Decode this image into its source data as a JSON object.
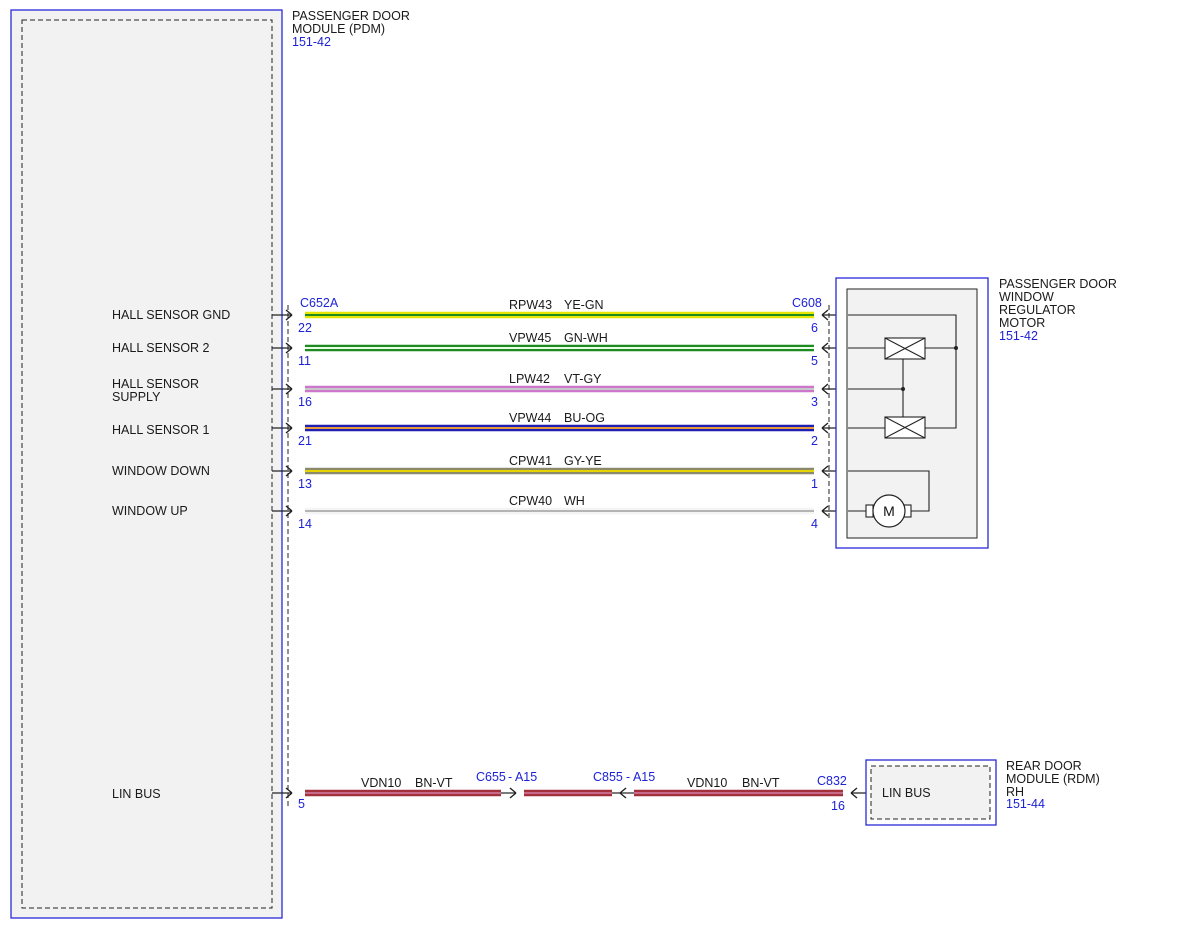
{
  "pdm": {
    "name_lines": [
      "PASSENGER DOOR",
      "MODULE (PDM)"
    ],
    "ref": "151-42",
    "connector": "C652A",
    "pins": [
      {
        "label_lines": [
          "HALL SENSOR GND"
        ],
        "pin": "22"
      },
      {
        "label_lines": [
          "HALL SENSOR 2"
        ],
        "pin": "11"
      },
      {
        "label_lines": [
          "HALL SENSOR",
          "SUPPLY"
        ],
        "pin": "16"
      },
      {
        "label_lines": [
          "HALL SENSOR 1"
        ],
        "pin": "21"
      },
      {
        "label_lines": [
          "WINDOW DOWN"
        ],
        "pin": "13"
      },
      {
        "label_lines": [
          "WINDOW UP"
        ],
        "pin": "14"
      },
      {
        "label_lines": [
          "LIN BUS"
        ],
        "pin": "5"
      }
    ]
  },
  "motor": {
    "name_lines": [
      "PASSENGER DOOR",
      "WINDOW",
      "REGULATOR",
      "MOTOR"
    ],
    "ref": "151-42",
    "connector": "C608",
    "symbol_label": "M"
  },
  "rdm": {
    "name_lines": [
      "REAR DOOR",
      "MODULE (RDM)",
      "RH"
    ],
    "ref": "151-44",
    "connector": "C832",
    "pin": "16",
    "pin_label": "LIN BUS"
  },
  "wires": [
    {
      "circuit": "RPW43",
      "color_code": "YE-GN",
      "from_pin": "22",
      "to_pin": "6",
      "colors": [
        "#e6e600",
        "#1e8c1e"
      ]
    },
    {
      "circuit": "VPW45",
      "color_code": "GN-WH",
      "from_pin": "11",
      "to_pin": "5",
      "colors": [
        "#1f8a1f",
        "#e8ffe8"
      ]
    },
    {
      "circuit": "LPW42",
      "color_code": "VT-GY",
      "from_pin": "16",
      "to_pin": "3",
      "colors": [
        "#cc77cc",
        "#c8c8c8"
      ]
    },
    {
      "circuit": "VPW44",
      "color_code": "BU-OG",
      "from_pin": "21",
      "to_pin": "2",
      "colors": [
        "#1f1fb4",
        "#e89a3c"
      ]
    },
    {
      "circuit": "CPW41",
      "color_code": "GY-YE",
      "from_pin": "13",
      "to_pin": "1",
      "colors": [
        "#8a8a6a",
        "#e6d400"
      ]
    },
    {
      "circuit": "CPW40",
      "color_code": "WH",
      "from_pin": "14",
      "to_pin": "4",
      "colors": [
        "#f4f4f4",
        "#b4b4b4"
      ]
    }
  ],
  "lin": {
    "seg1": {
      "circuit": "VDN10",
      "color_code": "BN-VT"
    },
    "seg2": {
      "circuit": "VDN10",
      "color_code": "BN-VT"
    },
    "inline1": {
      "connector": "C655",
      "pin": "- A15"
    },
    "inline2": {
      "connector": "C855",
      "pin": "- A15"
    },
    "colors": [
      "#a3303a",
      "#c86a8a"
    ]
  },
  "colors": {
    "module_border": "#2a2ad8",
    "module_fill": "#f2f2f2",
    "ref_text": "#1c22d6"
  }
}
